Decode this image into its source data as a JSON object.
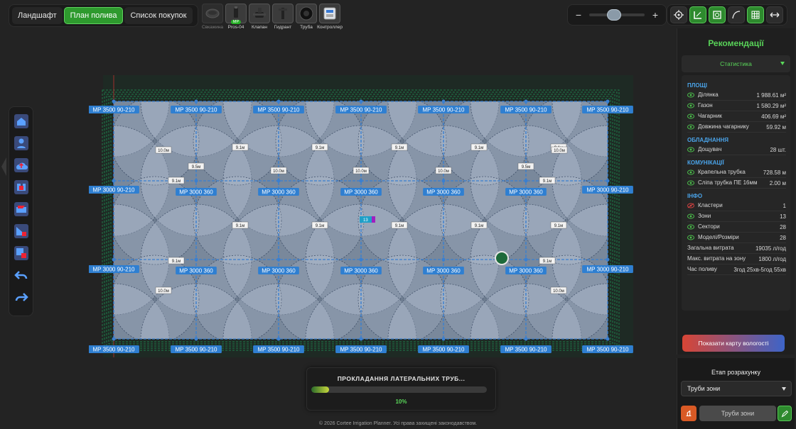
{
  "tabs": [
    {
      "label": "Ландшафт",
      "active": false
    },
    {
      "label": "План полива",
      "active": true
    },
    {
      "label": "Список покупок",
      "active": false
    }
  ],
  "components": [
    {
      "label": "Свкажина",
      "icon": "well-icon",
      "disabled": true
    },
    {
      "label": "Pros-04",
      "icon": "sprinkler-icon",
      "badge": "MP",
      "disabled": false
    },
    {
      "label": "Клапан",
      "icon": "valve-icon",
      "disabled": false
    },
    {
      "label": "Гидрант",
      "icon": "hydrant-icon",
      "disabled": false
    },
    {
      "label": "Труба",
      "icon": "pipe-icon",
      "disabled": false
    },
    {
      "label": "Контроллер",
      "icon": "controller-icon",
      "disabled": false
    }
  ],
  "zoom": {
    "minus": "−",
    "plus": "+",
    "level_fraction": 0.45
  },
  "tools": [
    "target-icon",
    "ruler-icon",
    "layers-icon",
    "curve-icon",
    "grid-icon",
    "expand-icon"
  ],
  "left_tools": [
    "home-icon",
    "user-icon",
    "cloud-upload-icon",
    "puzzle-icon",
    "zone-edit-icon",
    "zone-delete-icon",
    "zone-remove-icon",
    "undo-icon",
    "redo-icon"
  ],
  "canvas": {
    "sprinkler_labels_edge": "MP 3500 90-210",
    "sprinkler_labels_side": "MP 3000 90-210",
    "sprinkler_labels_inner": "MP 3000 360",
    "dim_labels": [
      "10.0м",
      "9.1м",
      "9.5м"
    ],
    "zone_tag": "13",
    "colors": {
      "area": "#8d9db5",
      "label_bg": "#2f7fd1",
      "hedge": "#1f7a4a"
    }
  },
  "right_panel": {
    "title": "Рекомендації",
    "stats_header": "Статистика",
    "sections": [
      {
        "title": "ПЛОЩІ",
        "rows": [
          {
            "label": "Ділянка",
            "value": "1 988.61 м²",
            "eye": "visible"
          },
          {
            "label": "Газон",
            "value": "1 580.29 м²",
            "eye": "visible"
          },
          {
            "label": "Чагарник",
            "value": "406.69 м²",
            "eye": "visible"
          },
          {
            "label": "Довжина чагарнику",
            "value": "59.92 м",
            "eye": "visible"
          }
        ]
      },
      {
        "title": "ОБЛАДНАННЯ",
        "rows": [
          {
            "label": "Дощувач",
            "value": "28 шт.",
            "eye": "visible"
          }
        ]
      },
      {
        "title": "КОМУНІКАЦІЇ",
        "rows": [
          {
            "label": "Крапельна трубка",
            "value": "728.58 м",
            "eye": "visible"
          },
          {
            "label": "Сліпа трубка ПЕ 16мм",
            "value": "2.00 м",
            "eye": "visible"
          }
        ]
      },
      {
        "title": "ІНФО",
        "rows": [
          {
            "label": "Кластери",
            "value": "1",
            "eye": "hidden"
          },
          {
            "label": "Зони",
            "value": "13",
            "eye": "visible"
          },
          {
            "label": "Сектори",
            "value": "28",
            "eye": "visible"
          },
          {
            "label": "Моделі/Розміри",
            "value": "28",
            "eye": "visible"
          },
          {
            "label": "Загальна витрата",
            "value": "19035 л/год",
            "eye": "none"
          },
          {
            "label": "Макс. витрата на зону",
            "value": "1800 л/год",
            "eye": "none"
          },
          {
            "label": "Час поливу",
            "value": "3год 25хв-5год 55хв",
            "eye": "none"
          }
        ]
      }
    ],
    "moisture_button": "Показати карту вологості"
  },
  "stage": {
    "title": "Етап розрахунку",
    "selected": "Труби зони",
    "action_label": "Труби зони"
  },
  "progress": {
    "title": "ПРОКЛАДАННЯ ЛАТЕРАЛЬНИХ ТРУБ...",
    "percent_label": "10%",
    "fraction": 0.1
  },
  "footer": "© 2026 Cortee Irrigation Planner. Усі права захищені законодавством."
}
